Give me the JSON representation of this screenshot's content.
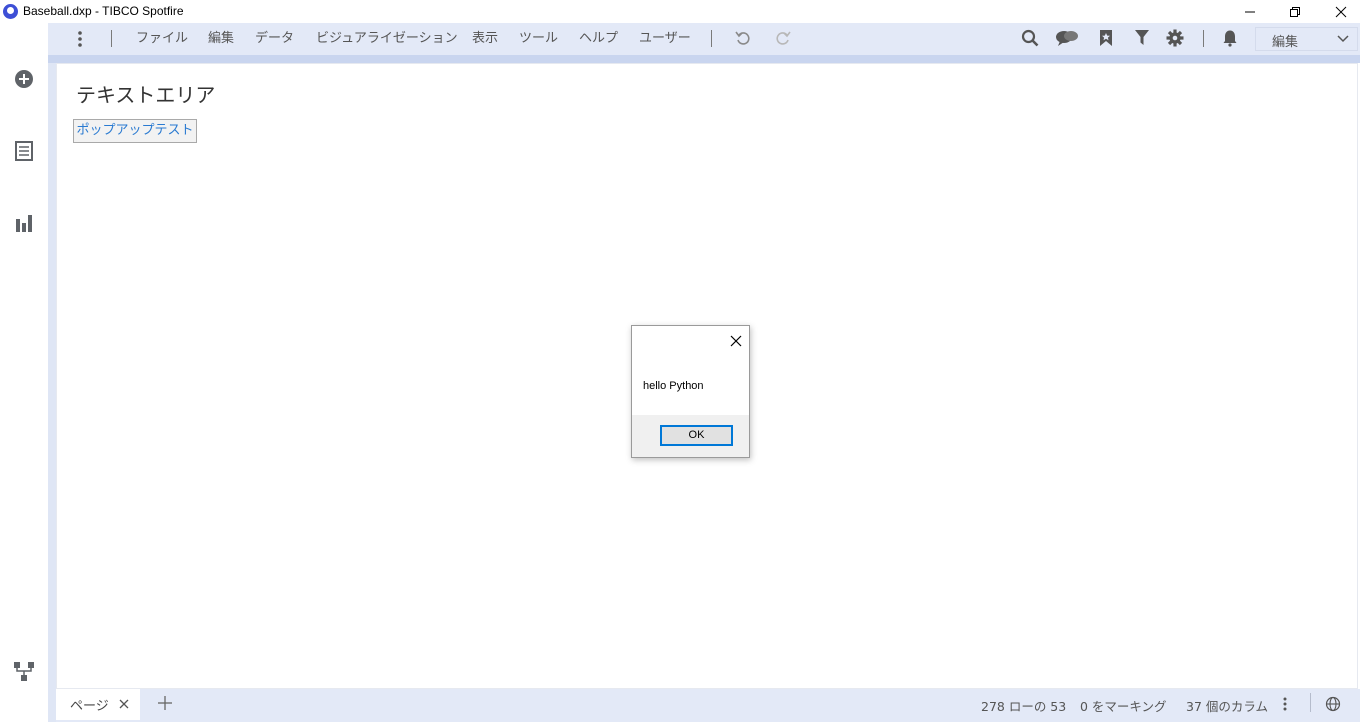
{
  "window": {
    "title": "Baseball.dxp - TIBCO Spotfire",
    "controls": [
      "minimize",
      "restore",
      "close"
    ]
  },
  "left_rail": {
    "icons": [
      "add-icon",
      "data-table-icon",
      "visualization-icon",
      "data-canvas-icon"
    ]
  },
  "menubar": {
    "items": [
      "ファイル",
      "編集",
      "データ",
      "ビジュアライゼーション",
      "表示",
      "ツール",
      "ヘルプ",
      "ユーザー"
    ],
    "toolbar_icons": [
      "undo-icon",
      "redo-icon",
      "search-icon",
      "comments-icon",
      "bookmark-icon",
      "filter-icon",
      "settings-icon",
      "notifications-icon"
    ],
    "mode_select": {
      "selected": "編集"
    }
  },
  "canvas": {
    "heading": "テキストエリア",
    "popup_button_label": "ポップアップテスト"
  },
  "dialog": {
    "message": "hello Python",
    "ok_label": "OK"
  },
  "bottombar": {
    "page_tab_label": "ページ",
    "rows_status": "278 ローの 53",
    "marking_status": "0 をマーキング",
    "columns_status": "37 個のカラム"
  },
  "colors": {
    "menubar_bg": "#e3e9f7",
    "accent_link": "#2a7ad1",
    "dialog_focus": "#0078d7",
    "logo": "#3d4fd6"
  }
}
